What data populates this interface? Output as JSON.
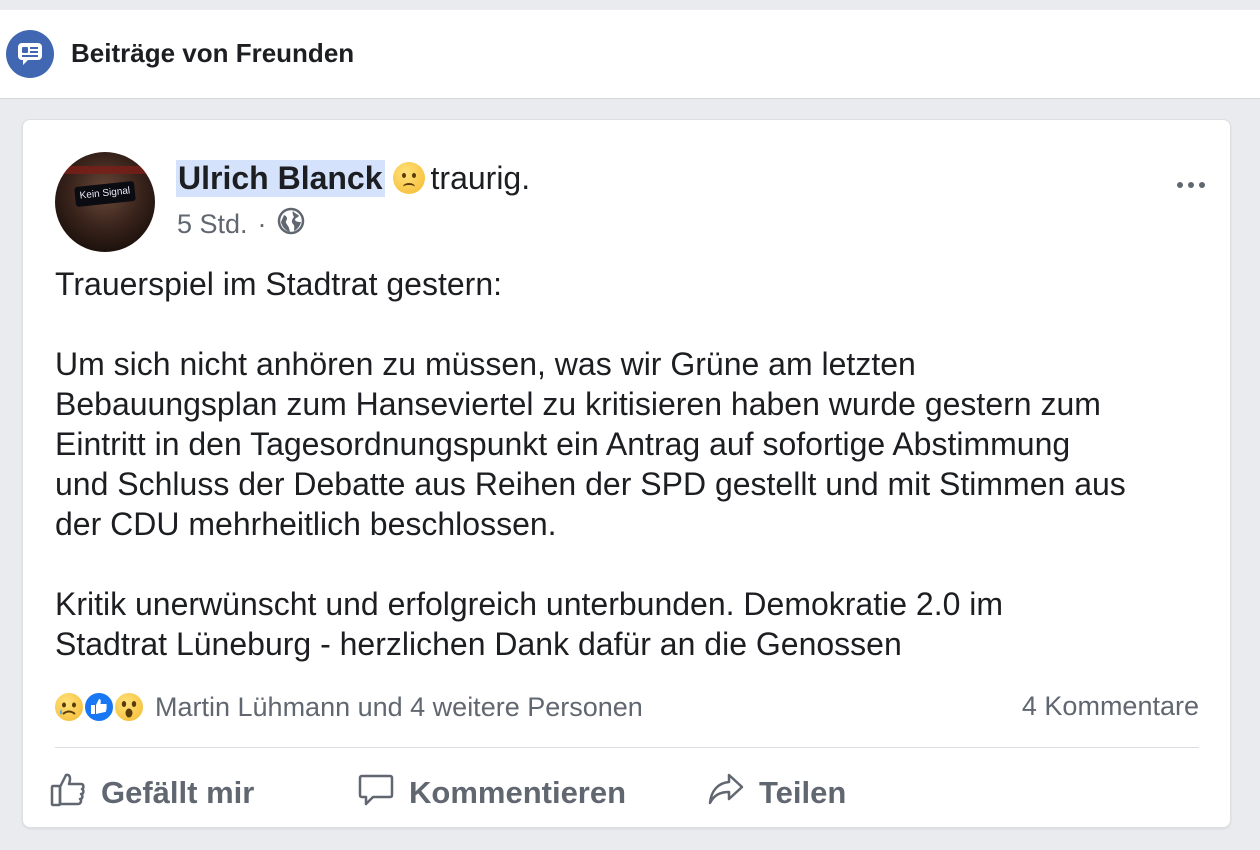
{
  "section": {
    "title": "Beiträge von Freunden",
    "icon": "friend-posts-icon"
  },
  "post": {
    "author": "Ulrich Blanck",
    "feeling": "traurig.",
    "feeling_icon": "sad-emoji-icon",
    "time": "5 Std.",
    "separator": "·",
    "privacy_icon": "globe-icon",
    "avatar_sign_text": "Kein Signal",
    "text": "Trauerspiel im Stadtrat gestern:\n\nUm sich nicht anhören zu müssen, was wir Grüne am letzten\nBebauungsplan zum Hanseviertel zu kritisieren haben wurde gestern zum\nEintritt in den Tagesordnungspunkt ein Antrag auf sofortige Abstimmung\nund Schluss der Debatte aus Reihen der SPD gestellt und mit Stimmen aus\nder CDU mehrheitlich beschlossen.\n\nKritik unerwünscht und erfolgreich unterbunden. Demokratie 2.0 im\nStadtrat Lüneburg - herzlichen Dank dafür an die Genossen",
    "reactions": {
      "icons": [
        "sad-reaction-icon",
        "like-reaction-icon",
        "wow-reaction-icon"
      ],
      "names": "Martin Lühmann und 4 weitere Personen"
    },
    "comments": "4 Kommentare"
  },
  "actions": {
    "like": "Gefällt mir",
    "comment": "Kommentieren",
    "share": "Teilen"
  },
  "colors": {
    "brand": "#4267b2",
    "like_blue": "#1877f2",
    "name_highlight": "#d4e3fb",
    "secondary_text": "#606770"
  }
}
